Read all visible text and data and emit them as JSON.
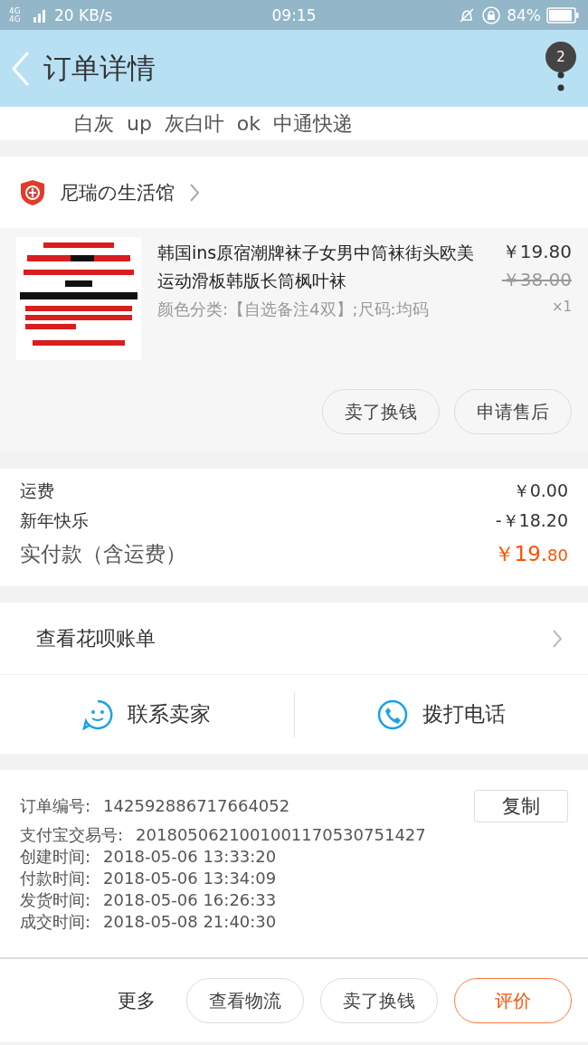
{
  "status_bar": {
    "network": "4G 4G",
    "speed": "20 KB/s",
    "time": "09:15",
    "battery": "84%"
  },
  "header": {
    "title": "订单详情",
    "badge": "2"
  },
  "cut_line": "白灰  up  灰白叶  ok  中通快递",
  "shop": {
    "name": "尼瑞の生活馆"
  },
  "product": {
    "image": {
      "kind": "picture"
    },
    "title": "韩国ins原宿潮牌袜子女男中筒袜街头欧美运动滑板韩版长筒枫叶袜",
    "sku": "颜色分类:【自选备注4双】;尺码:均码",
    "price": "￥19.80",
    "original_price": "￥38.00",
    "quantity": "×1",
    "actions": [
      "卖了换钱",
      "申请售后"
    ]
  },
  "fees": [
    {
      "label": "运费",
      "value": "￥0.00",
      "kind": "normal"
    },
    {
      "label": "新年快乐",
      "value": "-￥18.20",
      "kind": "normal"
    },
    {
      "label": "实付款（含运费）",
      "value": "￥19.",
      "value_small": "80",
      "kind": "total"
    }
  ],
  "huabei": {
    "label": "查看花呗账单"
  },
  "contact": [
    {
      "label": "联系卖家",
      "kind": "chat"
    },
    {
      "label": "拨打电话",
      "kind": "phone"
    }
  ],
  "order_info": {
    "copy_button": "复制",
    "rows": [
      {
        "label": "订单编号:",
        "value": "142592886717664052"
      },
      {
        "label": "支付宝交易号:",
        "value": "2018050621001001170530751427"
      },
      {
        "label": "创建时间:",
        "value": "2018-05-06 13:33:20"
      },
      {
        "label": "付款时间:",
        "value": "2018-05-06 13:34:09"
      },
      {
        "label": "发货时间:",
        "value": "2018-05-06 16:26:33"
      },
      {
        "label": "成交时间:",
        "value": "2018-05-08 21:40:30"
      }
    ]
  },
  "bottom_bar": {
    "more": "更多",
    "buttons": [
      {
        "label": "查看物流",
        "kind": "normal"
      },
      {
        "label": "卖了换钱",
        "kind": "normal"
      },
      {
        "label": "评价",
        "kind": "primary"
      }
    ]
  }
}
